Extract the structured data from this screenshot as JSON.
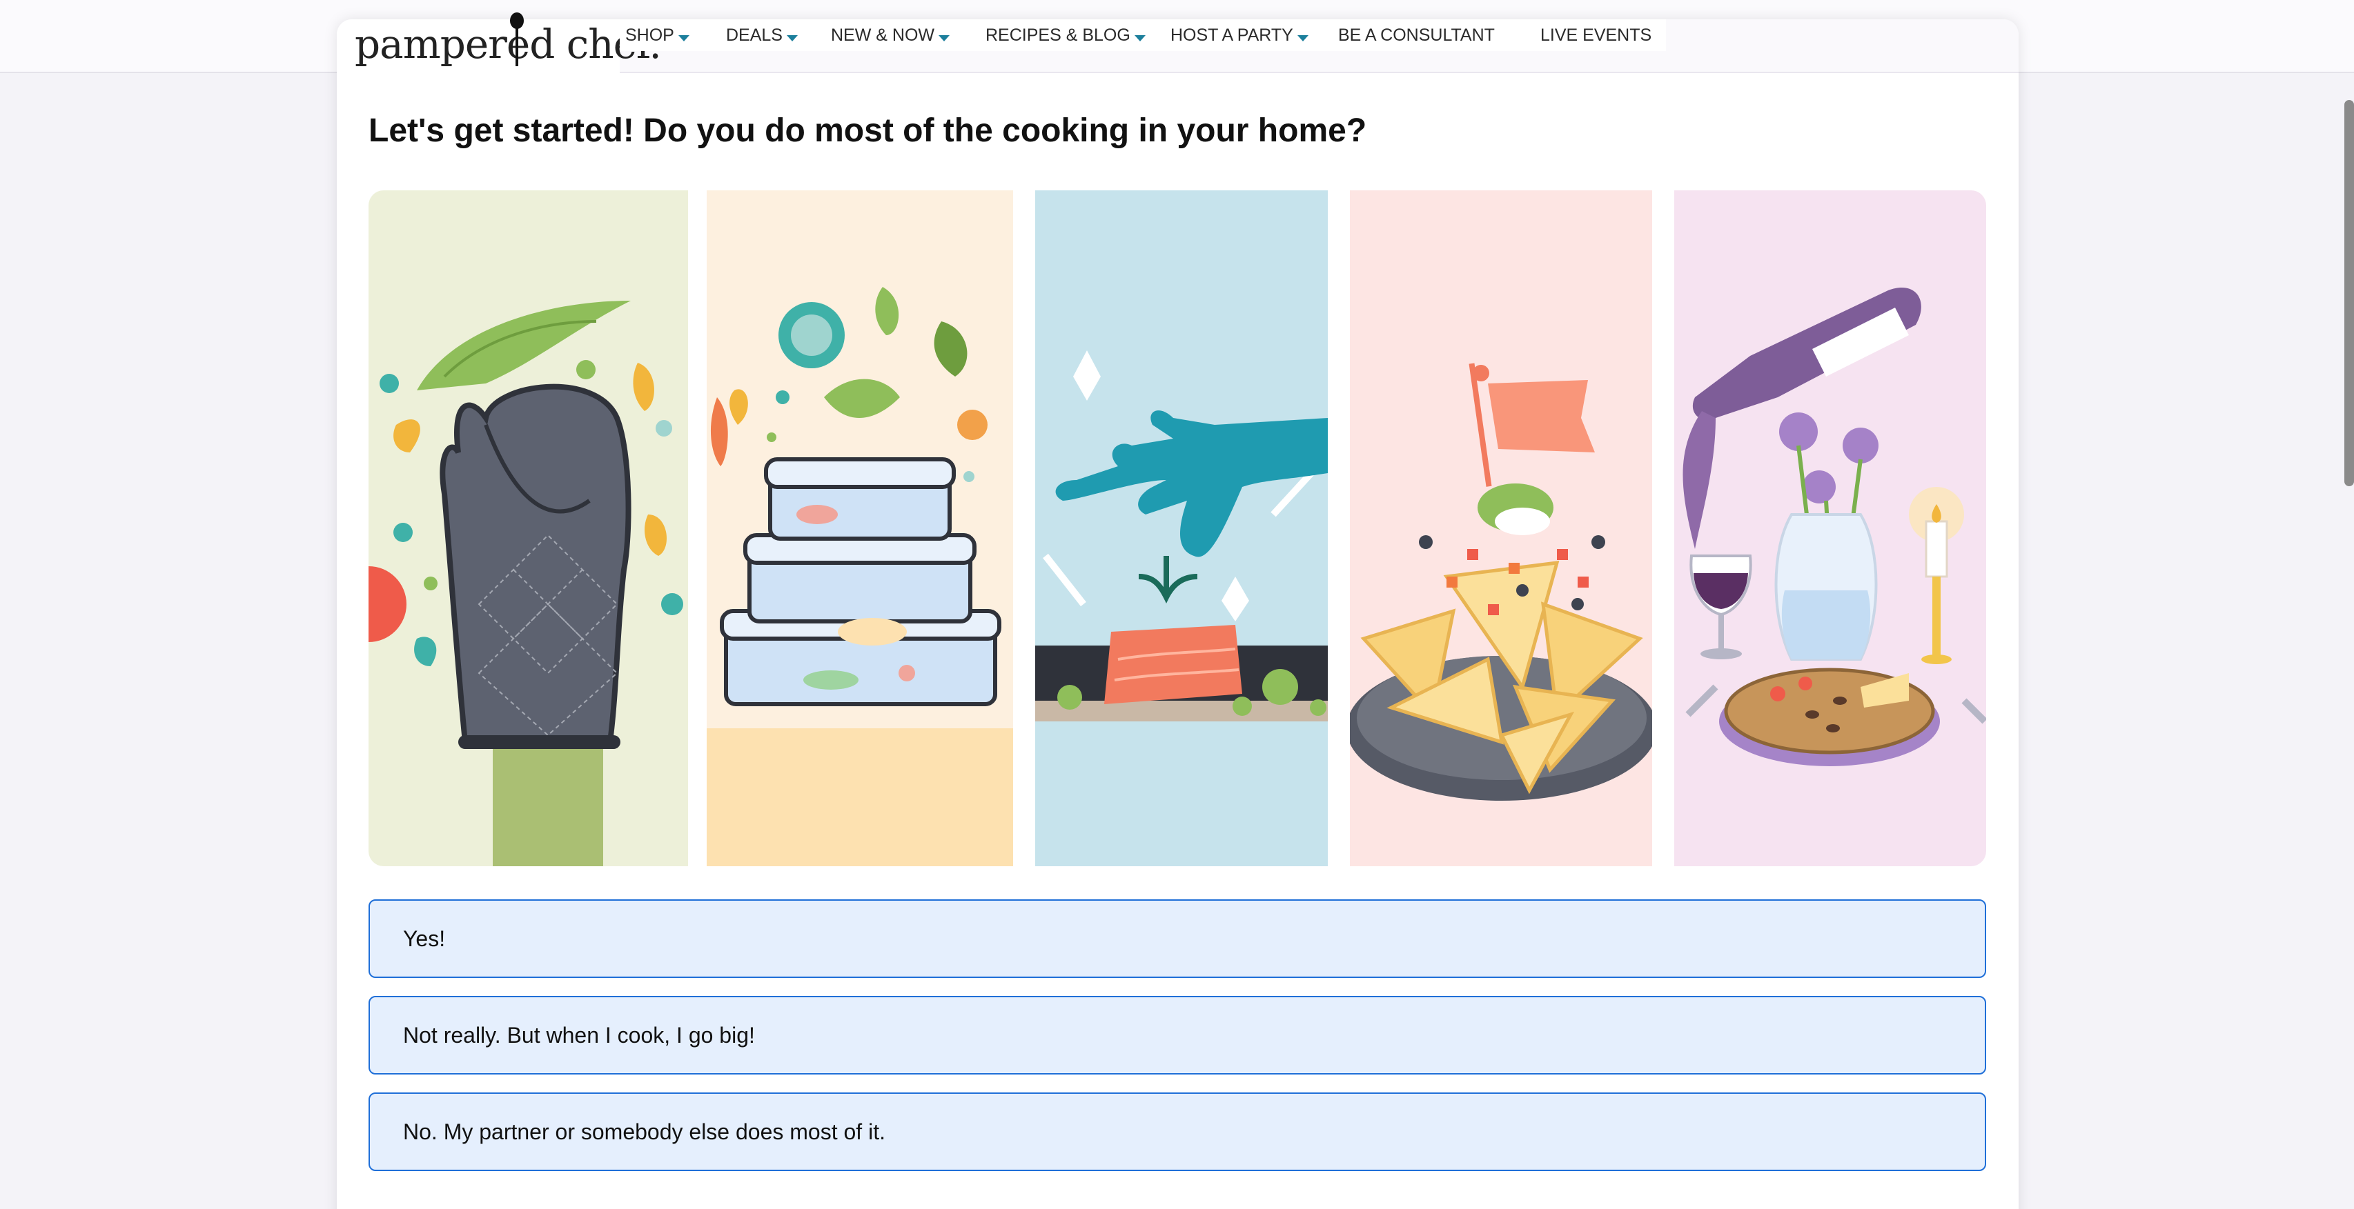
{
  "brand": {
    "name": "pampered chef."
  },
  "nav": {
    "items": [
      {
        "label": "SHOP",
        "has_menu": true
      },
      {
        "label": "DEALS",
        "has_menu": true
      },
      {
        "label": "NEW & NOW",
        "has_menu": true
      },
      {
        "label": "RECIPES & BLOG",
        "has_menu": true
      },
      {
        "label": "HOST A PARTY",
        "has_menu": true
      },
      {
        "label": "BE A CONSULTANT",
        "has_menu": false
      },
      {
        "label": "LIVE EVENTS",
        "has_menu": false
      }
    ],
    "caret_color": "#1c7f9c"
  },
  "quiz": {
    "question": "Let's get started! Do you do most of the cooking in your home?",
    "illustrations": [
      {
        "icon": "oven-mitt-icon",
        "bg": "#edf0d9"
      },
      {
        "icon": "food-storage-containers-icon",
        "bg": "#fdf0df"
      },
      {
        "icon": "hand-garnishing-salmon-icon",
        "bg": "#c6e3ec"
      },
      {
        "icon": "nachos-platter-icon",
        "bg": "#fde5e3"
      },
      {
        "icon": "wine-and-charcuterie-icon",
        "bg": "#f6e3f1"
      }
    ],
    "options": [
      {
        "label": "Yes!"
      },
      {
        "label": "Not really. But when I cook, I go big!"
      },
      {
        "label": "No. My partner or somebody else does most of it."
      }
    ],
    "option_bg": "#e5effd",
    "option_border": "#1f6fd8"
  }
}
